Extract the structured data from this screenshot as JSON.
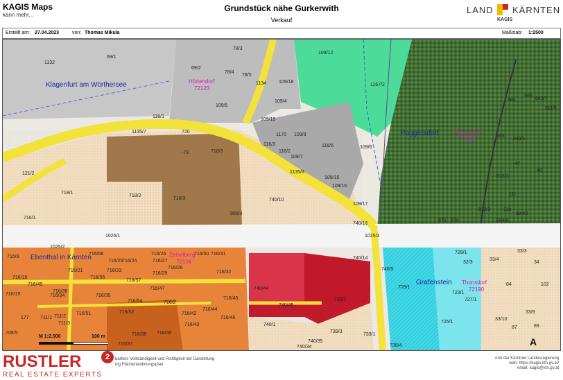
{
  "header": {
    "app_title": "KAGIS Maps",
    "app_subtitle": "kann mehr...",
    "doc_title": "Grundstück nähe Gurkerwith",
    "doc_subtitle": "Verkauf",
    "brand_left": "LAND",
    "brand_right": "KÄRNTEN",
    "brand_sub": "KAGIS",
    "brand_colors": [
      "#f5b800",
      "#c62828"
    ]
  },
  "meta": {
    "created_label": "Erstellt am:",
    "created_date": "27.04.2023",
    "by_label": "von:",
    "author": "Thomas Mikula",
    "scale_label": "Maßstab:",
    "scale_value": "1:2500"
  },
  "map": {
    "places": [
      {
        "text": "Klagenfurt am Wörthersee"
      },
      {
        "text": "Poggersdorf"
      },
      {
        "text": "Ebenthal in Kärnten"
      },
      {
        "text": "Grafenstein"
      }
    ],
    "pink_places": [
      {
        "name": "Hörtendorf",
        "code": "72123"
      },
      {
        "name": "Pubersdorf",
        "code": "72134"
      },
      {
        "name": "Zeiselberg",
        "code": "72104"
      },
      {
        "name": "Thonsdorf",
        "code": "72190"
      }
    ],
    "parcels": [
      "69/1",
      "1132",
      "78/3",
      "78/5",
      "69/2",
      "78/4",
      "109/12",
      "109/18",
      "1167/2",
      "1134",
      "109/4",
      "109/5",
      "118/1",
      "109/19",
      "1135/7",
      "720",
      "718/3",
      "1170",
      "109/9",
      "116/3",
      "116/5",
      "109/6",
      "116/2",
      "109/7",
      "121/2",
      "-79",
      "1135/8",
      "109/15",
      "109/16",
      "718/1",
      "718/2",
      "716/3",
      "740/10",
      "109/17",
      "716/1",
      "990/4",
      "740/16",
      "1025/1",
      "1025/3",
      "1025/2",
      "716/9",
      "716/56",
      "716/26",
      "716/50",
      "716/31",
      "716/25",
      "716/24",
      "716/27",
      "716/28",
      "716/21",
      "716/23",
      "716/29",
      "716/55",
      "716/57",
      "716/32",
      "716/35",
      "716/18",
      "716/36",
      "716/15",
      "716/47",
      "716/49",
      "716/34",
      "716/54",
      "716/2",
      "716/45",
      "716/51",
      "716/52",
      "716/42",
      "716/44",
      "711/1",
      "711/2",
      "716/46",
      "711/3",
      "716/43",
      "716/38",
      "716/40",
      "716/37",
      "708/5",
      "740/14",
      "740/44",
      "740/5",
      "740/45",
      "738/1",
      "740/1",
      "739/3",
      "739/1",
      "740/35",
      "740/34",
      "738/4",
      "709/1",
      "728/1",
      "723/1",
      "727/1",
      "725/1",
      "33/3",
      "32/3",
      "33/4",
      "34",
      "84",
      "102",
      "33/9",
      "33/10",
      "87",
      "89",
      "985",
      "986",
      "843/7",
      "811/6",
      "983",
      "843/1",
      "-47",
      "46",
      "813/1",
      "111",
      "813/3",
      "110",
      "684/2",
      "684/8",
      "876",
      "878",
      "177"
    ],
    "scale_bar": {
      "label_left": "M 1:2.500",
      "label_right": "100 m"
    },
    "north_arrow": "A",
    "colors": {
      "road": "#f2e23a",
      "road_outline": "#b8a800",
      "highway": "#f0f0f0",
      "residential": "#f5d9b8",
      "brown_zone": "#a0784a",
      "orange_zone": "#e8843a",
      "red_zone": "#c2182b",
      "green_zone": "#4ddb9a",
      "cyan_zone": "#3fd8e6",
      "grey_buildings": "#9a9a9a",
      "forest": "#4a7a3a"
    }
  },
  "footer": {
    "logo_text": "RUSTLER",
    "logo_badge": "2",
    "logo_tagline": "REAL ESTATE EXPERTS",
    "disclaimer_1": "barkeit, Vollständigkeit und Richtigkeit der Darstellung",
    "disclaimer_2": "ing Flächenwidmungsplan",
    "address_1": "Amt der Kärntner Landesregierung",
    "address_2": "web: https://kagis.ktn.gv.at/",
    "address_3": "email: kagis@ktn.gv.at"
  }
}
